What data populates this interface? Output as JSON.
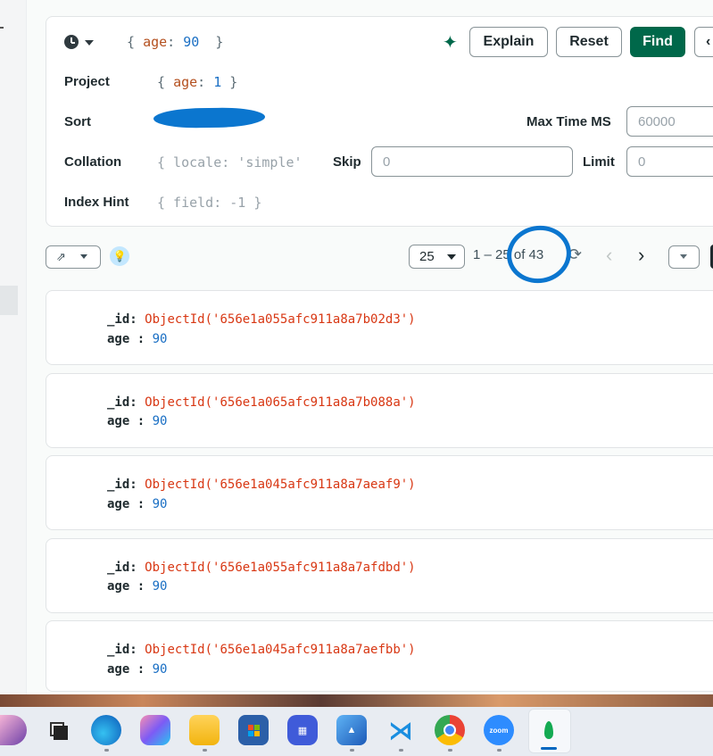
{
  "query": {
    "filter": {
      "open": "{",
      "key": "age",
      "value": "90",
      "close": "}"
    },
    "project_label": "Project",
    "project": {
      "open": "{",
      "key": "age",
      "value": "1",
      "close": "}"
    },
    "sort_label": "Sort",
    "max_time_label": "Max Time MS",
    "max_time_placeholder": "60000",
    "collation_label": "Collation",
    "collation_placeholder": "{ locale: 'simple'",
    "skip_label": "Skip",
    "skip_placeholder": "0",
    "limit_label": "Limit",
    "limit_placeholder": "0",
    "index_hint_label": "Index Hint",
    "index_hint_placeholder": "{ field: -1 }",
    "explain_label": "Explain",
    "reset_label": "Reset",
    "find_label": "Find"
  },
  "results_toolbar": {
    "page_size": "25",
    "range_text": "1 – 25 of 43"
  },
  "documents": [
    {
      "id_key": "_id",
      "id_value": "ObjectId('656e1a055afc911a8a7b02d3')",
      "age_key": "age",
      "age_value": "90"
    },
    {
      "id_key": "_id",
      "id_value": "ObjectId('656e1a065afc911a8a7b088a')",
      "age_key": "age",
      "age_value": "90"
    },
    {
      "id_key": "_id",
      "id_value": "ObjectId('656e1a045afc911a8a7aeaf9')",
      "age_key": "age",
      "age_value": "90"
    },
    {
      "id_key": "_id",
      "id_value": "ObjectId('656e1a055afc911a8a7afdbd')",
      "age_key": "age",
      "age_value": "90"
    },
    {
      "id_key": "_id",
      "id_value": "ObjectId('656e1a045afc911a8a7aefbb')",
      "age_key": "age",
      "age_value": "90"
    }
  ],
  "taskbar": {
    "zoom_label": "zoom"
  },
  "colors": {
    "find_button": "#00684a",
    "object_id": "#d83713",
    "number": "#1a6fc4",
    "annotation": "#0b76cf"
  },
  "icons": [
    "clock-icon",
    "sparkle-icon",
    "export-icon",
    "lightbulb-icon",
    "refresh-icon",
    "chevron-left-icon",
    "chevron-right-icon",
    "mongodb-icon"
  ]
}
